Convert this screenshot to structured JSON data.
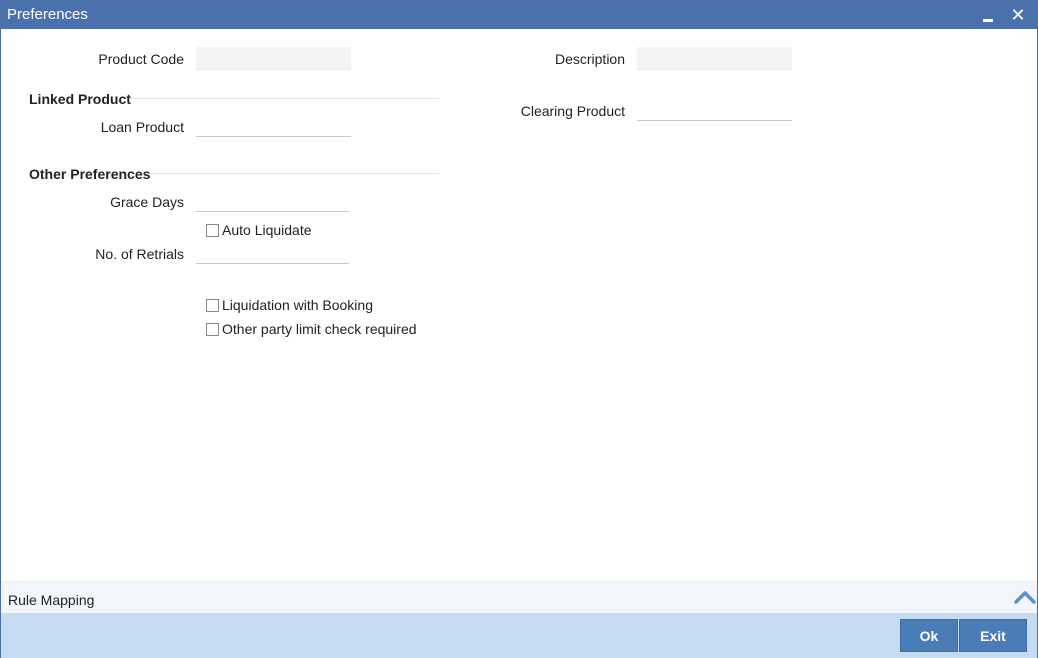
{
  "window": {
    "title": "Preferences",
    "minimize_label": "",
    "close_label": "✕"
  },
  "form": {
    "product_code": {
      "label": "Product Code",
      "value": ""
    },
    "description": {
      "label": "Description",
      "value": ""
    },
    "linked_product": {
      "heading": "Linked Product",
      "loan_product": {
        "label": "Loan Product",
        "value": ""
      },
      "clearing_product": {
        "label": "Clearing Product",
        "value": ""
      }
    },
    "other_preferences": {
      "heading": "Other Preferences",
      "grace_days": {
        "label": "Grace Days",
        "value": ""
      },
      "auto_liquidate": {
        "label": "Auto Liquidate",
        "checked": false
      },
      "no_of_retrials": {
        "label": "No. of Retrials",
        "value": ""
      },
      "liquidation_with_booking": {
        "label": "Liquidation with Booking",
        "checked": false
      },
      "other_party_limit_check": {
        "label": "Other party limit check required",
        "checked": false
      }
    }
  },
  "rule_bar": {
    "label": "Rule Mapping"
  },
  "footer": {
    "ok_label": "Ok",
    "exit_label": "Exit"
  },
  "colors": {
    "titlebar": "#4a70ad",
    "footer": "#c5dcf0",
    "button": "#4a7cb8"
  }
}
